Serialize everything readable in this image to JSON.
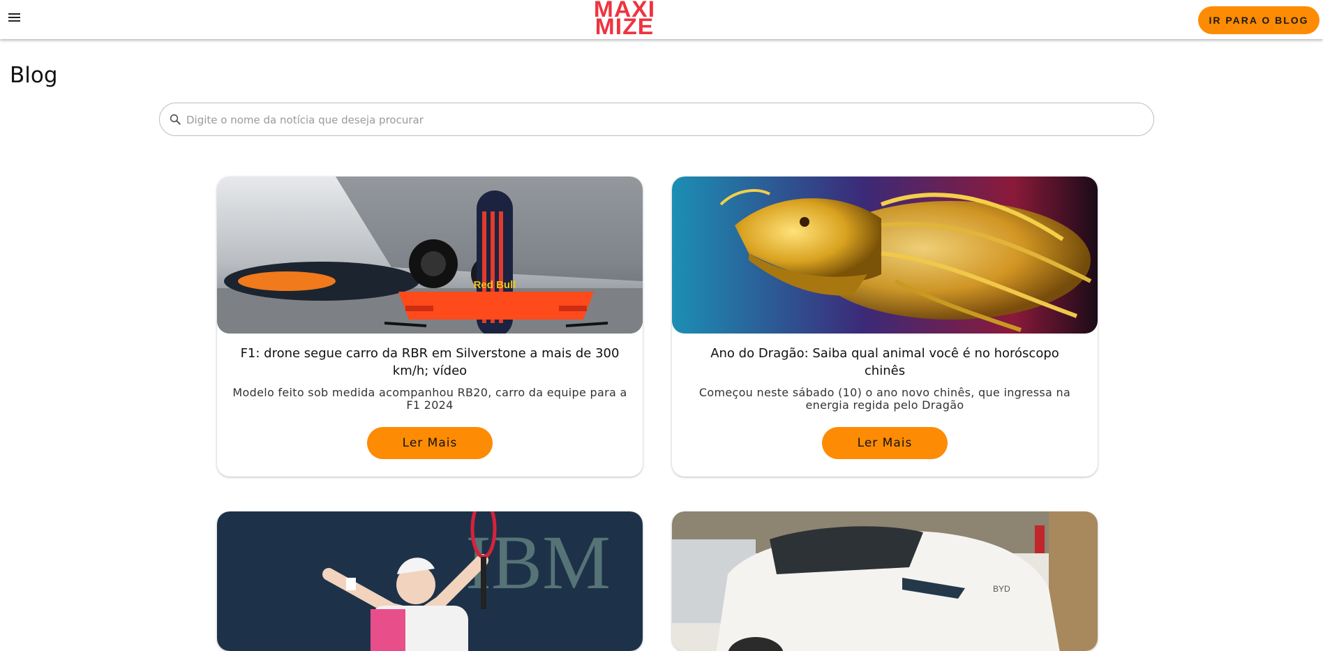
{
  "header": {
    "logo_line1": "MAXI",
    "logo_line2": "MIZE",
    "cta_label": "IR PARA O BLOG",
    "brand_color": "#ef3340",
    "accent_color": "#fd8b03"
  },
  "page": {
    "title": "Blog"
  },
  "search": {
    "placeholder": "Digite o nome da notícia que deseja procurar",
    "value": ""
  },
  "cards": [
    {
      "title": "F1: drone segue carro da RBR em Silverstone a mais de 300 km/h; vídeo",
      "description": "Modelo feito sob medida acompanhou RB20, carro da equipe para a F1 2024",
      "button_label": "Ler Mais",
      "image": "red-bull-drone-and-f1-car-photo",
      "image_text": "Red Bull"
    },
    {
      "title": "Ano do Dragão: Saiba qual animal você é no horóscopo chinês",
      "description": "Começou neste sábado (10) o ano novo chinês, que ingressa na energia regida pelo Dragão",
      "button_label": "Ler Mais",
      "image": "golden-dragon-statue-photo"
    },
    {
      "title": "",
      "description": "",
      "button_label": "",
      "image": "tennis-player-celebrating-photo",
      "image_text": "IBM"
    },
    {
      "title": "",
      "description": "",
      "button_label": "",
      "image": "white-electric-car-photo",
      "image_text": "BYD"
    }
  ]
}
